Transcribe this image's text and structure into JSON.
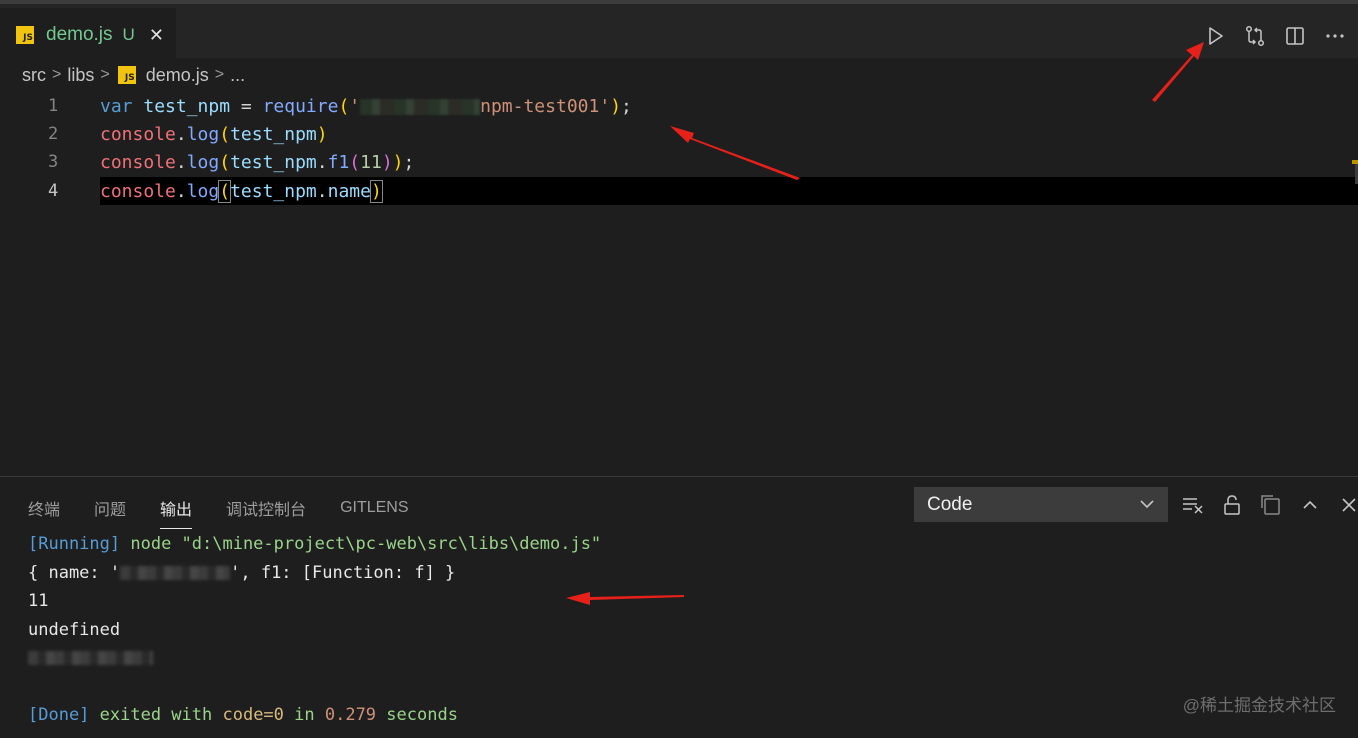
{
  "tab": {
    "filename": "demo.js",
    "status": "U",
    "close": "✕",
    "badge": "JS"
  },
  "editor_actions": [
    "run-icon",
    "compare-changes-icon",
    "split-editor-icon",
    "more-actions-icon"
  ],
  "breadcrumb": {
    "items": [
      "src",
      "libs",
      "demo.js",
      "..."
    ],
    "separator": ">"
  },
  "code_lines": [
    {
      "num": "1",
      "text": "var test_npm = require('npm-test001');"
    },
    {
      "num": "2",
      "text": "console.log(test_npm)"
    },
    {
      "num": "3",
      "text": "console.log(test_npm.f1(11));"
    },
    {
      "num": "4",
      "text": "console.log(test_npm.name)"
    }
  ],
  "code_tokens": {
    "l1_kw": "var",
    "l1_var": " test_npm ",
    "l1_eq": "= ",
    "l1_fn": "require",
    "l1_open": "(",
    "l1_str_open": "'",
    "l1_str": "npm-test001",
    "l1_str_close": "'",
    "l1_close": ")",
    "l1_semi": ";",
    "console": "console",
    "dot": ".",
    "log": "log",
    "test_npm": "test_npm",
    "f1": "f1",
    "num11": "11",
    "name": "name",
    "open": "(",
    "close": ")",
    "semi": ";"
  },
  "panel": {
    "tabs": [
      "终端",
      "问题",
      "输出",
      "调试控制台",
      "GITLENS"
    ],
    "active_tab": "输出",
    "select_value": "Code",
    "actions": [
      "clear-output-icon",
      "lock-scroll-icon",
      "open-log-icon",
      "maximize-panel-icon",
      "close-panel-icon"
    ]
  },
  "output": {
    "running_tag": "[Running]",
    "running_cmd": " node \"d:\\mine-project\\pc-web\\src\\libs\\demo.js\"",
    "line2_pre": "{ name: '",
    "line2_post": "', f1: [Function: f] }",
    "line3": "11",
    "line4": "undefined",
    "done_tag": "[Done]",
    "done_exited": " exited with ",
    "done_code": "code=0",
    "done_in": " in ",
    "done_time": "0.279",
    "done_seconds": " seconds"
  },
  "watermark": "@稀土掘金技术社区",
  "colors": {
    "accent_green": "#73c991",
    "arrow_red": "#e8201a",
    "js_badge": "#f1c40f"
  }
}
